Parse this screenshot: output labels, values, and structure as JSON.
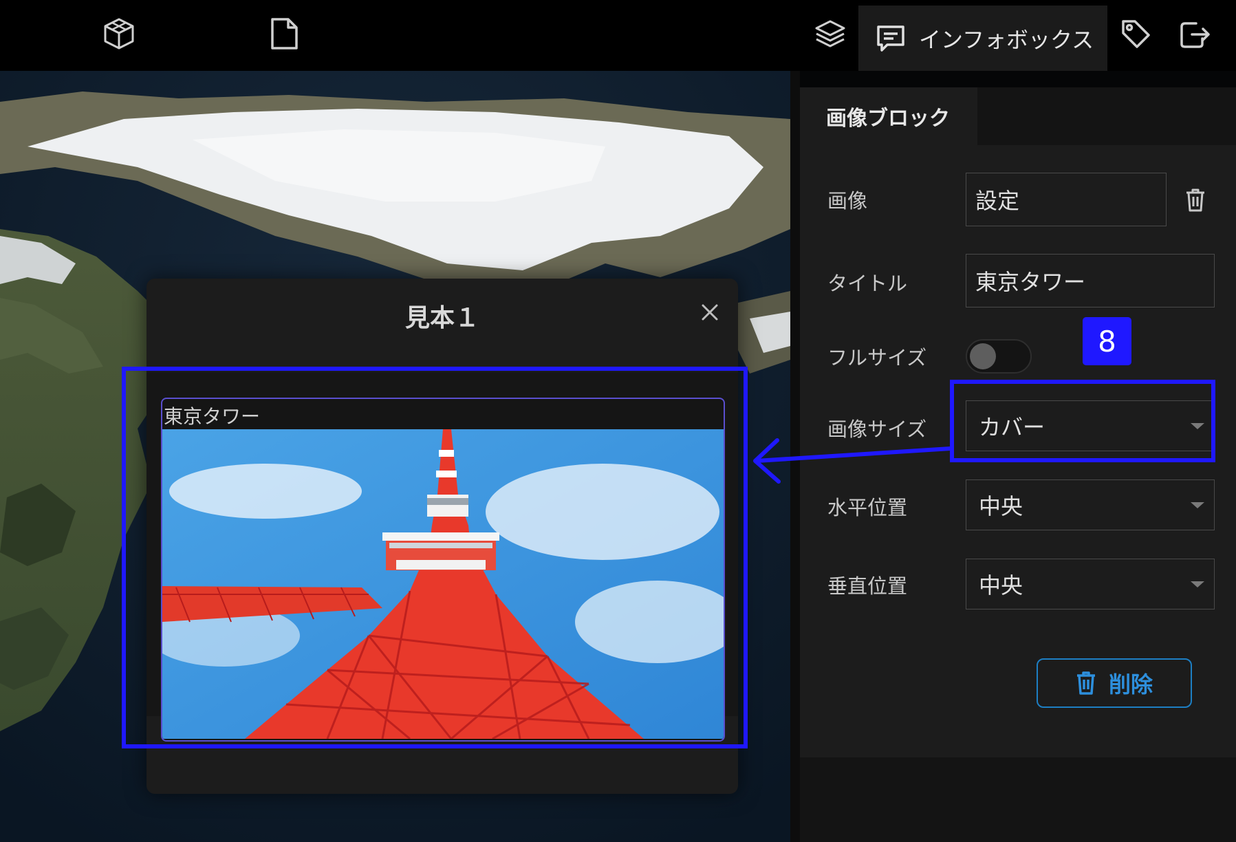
{
  "toolbar": {
    "left_icons": [
      "cube-outline-icon",
      "document-icon"
    ],
    "right_icons": [
      "layers-icon",
      "tag-icon",
      "export-icon"
    ],
    "active_tab": {
      "icon": "infobox-icon",
      "label": "インフォボックス"
    }
  },
  "panel": {
    "tab_label": "画像ブロック",
    "fields": {
      "image": {
        "label": "画像",
        "value": "設定"
      },
      "title": {
        "label": "タイトル",
        "value": "東京タワー"
      },
      "fullsize": {
        "label": "フルサイズ",
        "enabled": false
      },
      "image_size": {
        "label": "画像サイズ",
        "value": "カバー"
      },
      "horizontal": {
        "label": "水平位置",
        "value": "中央"
      },
      "vertical": {
        "label": "垂直位置",
        "value": "中央"
      }
    },
    "delete_label": "削除"
  },
  "dialog": {
    "title": "見本１",
    "block_title": "東京タワー",
    "image_subject": "Tokyo Tower photo"
  },
  "annotation": {
    "step_number": "8",
    "color": "#1f18ff"
  }
}
